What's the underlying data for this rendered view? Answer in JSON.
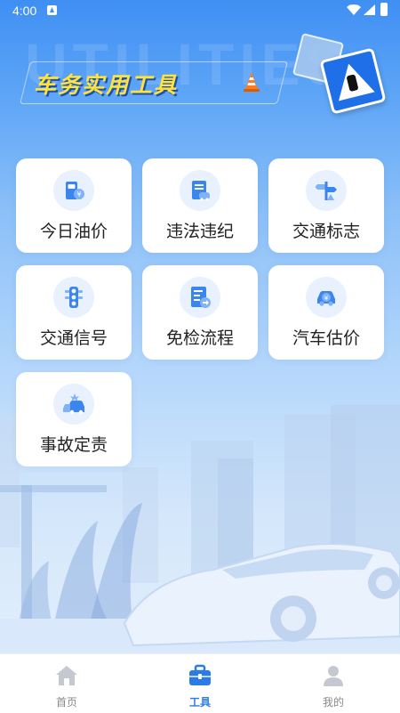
{
  "status_bar": {
    "time": "4:00",
    "icons": [
      "notification-icon",
      "wifi-icon",
      "signal-icon",
      "battery-icon"
    ]
  },
  "banner": {
    "title": "车务实用工具",
    "background_text": "UTILITIES"
  },
  "tools": [
    {
      "label": "今日油价",
      "icon": "fuel-price-icon"
    },
    {
      "label": "违法违纪",
      "icon": "violation-document-icon"
    },
    {
      "label": "交通标志",
      "icon": "traffic-sign-icon"
    },
    {
      "label": "交通信号",
      "icon": "traffic-light-icon"
    },
    {
      "label": "免检流程",
      "icon": "inspection-icon"
    },
    {
      "label": "汽车估价",
      "icon": "car-valuation-icon"
    },
    {
      "label": "事故定责",
      "icon": "accident-icon"
    }
  ],
  "bottom_nav": {
    "items": [
      {
        "label": "首页",
        "icon": "home-icon",
        "active": false
      },
      {
        "label": "工具",
        "icon": "toolbox-icon",
        "active": true
      },
      {
        "label": "我的",
        "icon": "user-icon",
        "active": false
      }
    ]
  },
  "colors": {
    "accent": "#2a7be8",
    "banner_title": "#ffe23a",
    "card_background": "#ffffff",
    "icon_circle": "#e8f1fd"
  }
}
